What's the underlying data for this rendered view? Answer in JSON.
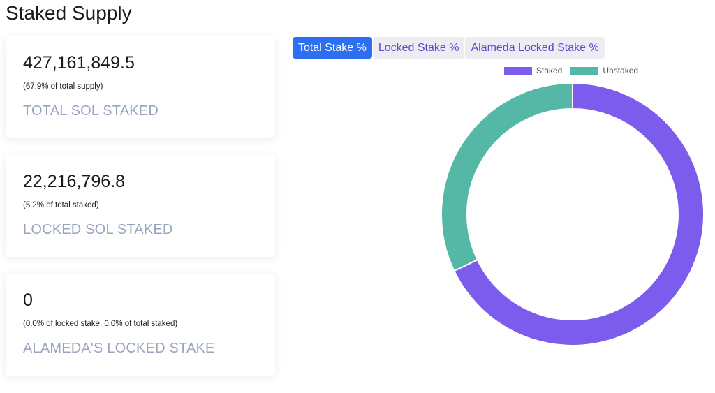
{
  "page": {
    "title": "Staked Supply"
  },
  "cards": [
    {
      "value": "427,161,849.5",
      "sub": "(67.9% of total supply)",
      "label": "TOTAL SOL STAKED"
    },
    {
      "value": "22,216,796.8",
      "sub": "(5.2% of total staked)",
      "label": "LOCKED SOL STAKED"
    },
    {
      "value": "0",
      "sub": "(0.0% of locked stake, 0.0% of total staked)",
      "label": "ALAMEDA'S LOCKED STAKE"
    }
  ],
  "tabs": [
    {
      "label": "Total Stake %",
      "active": true
    },
    {
      "label": "Locked Stake %",
      "active": false
    },
    {
      "label": "Alameda Locked Stake %",
      "active": false
    }
  ],
  "colors": {
    "staked": "#7b5cec",
    "unstaked": "#55b7a6",
    "active_tab": "#2d6ff0"
  },
  "chart_data": {
    "type": "pie",
    "categories": [
      "Staked",
      "Unstaked"
    ],
    "values": [
      67.9,
      32.1
    ],
    "legend": "top",
    "colors": [
      "#7b5cec",
      "#55b7a6"
    ]
  }
}
